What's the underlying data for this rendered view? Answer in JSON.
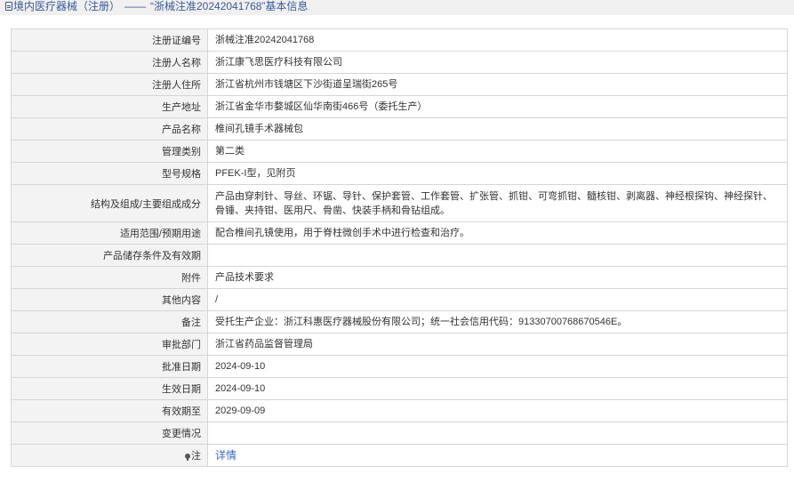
{
  "header": {
    "title": "境内医疗器械（注册）",
    "separator": "——",
    "subtitle": "“浙械注准20242041768”基本信息"
  },
  "rows": [
    {
      "label": "注册证编号",
      "value": "浙械注准20242041768"
    },
    {
      "label": "注册人名称",
      "value": "浙江康飞思医疗科技有限公司"
    },
    {
      "label": "注册人住所",
      "value": "浙江省杭州市钱塘区下沙街道呈瑞街265号"
    },
    {
      "label": "生产地址",
      "value": "浙江省金华市婺城区仙华南街466号（委托生产）"
    },
    {
      "label": "产品名称",
      "value": "椎间孔镜手术器械包"
    },
    {
      "label": "管理类别",
      "value": "第二类"
    },
    {
      "label": "型号规格",
      "value": "PFEK-I型，见附页"
    },
    {
      "label": "结构及组成/主要组成成分",
      "value": "产品由穿刺针、导丝、环锯、导针、保护套管、工作套管、扩张管、抓钳、可弯抓钳、髓核钳、剥离器、神经根探钩、神经探针、骨锤、夹持钳、医用尺、骨凿、快装手柄和骨钻组成。"
    },
    {
      "label": "适用范围/预期用途",
      "value": "配合椎间孔镜使用，用于脊柱微创手术中进行检查和治疗。"
    },
    {
      "label": "产品储存条件及有效期",
      "value": ""
    },
    {
      "label": "附件",
      "value": "产品技术要求"
    },
    {
      "label": "其他内容",
      "value": "/"
    },
    {
      "label": "备注",
      "value": "受托生产企业：浙江科惠医疗器械股份有限公司；统一社会信用代码：91330700768670546E。"
    },
    {
      "label": "审批部门",
      "value": "浙江省药品监督管理局"
    },
    {
      "label": "批准日期",
      "value": "2024-09-10"
    },
    {
      "label": "生效日期",
      "value": "2024-09-10"
    },
    {
      "label": "有效期至",
      "value": "2029-09-09"
    },
    {
      "label": "变更情况",
      "value": ""
    }
  ],
  "note_row": {
    "label": "注",
    "icon": "pin-icon",
    "link": "详情"
  }
}
